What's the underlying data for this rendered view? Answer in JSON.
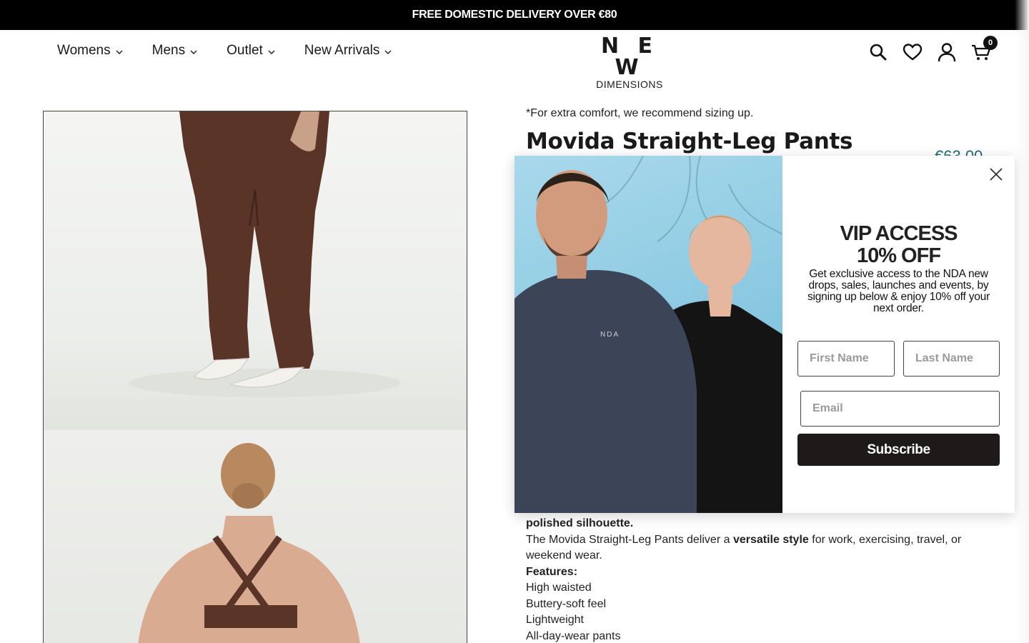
{
  "announcement": "FREE DOMESTIC DELIVERY OVER €80",
  "nav": {
    "womens": "Womens",
    "mens": "Mens",
    "outlet": "Outlet",
    "new_arrivals": "New Arrivals"
  },
  "logo": {
    "top": "N E W",
    "bottom": "DIMENSIONS"
  },
  "header_icons": [
    "search-icon",
    "heart-icon",
    "account-icon",
    "cart-icon"
  ],
  "cart_count": "0",
  "product": {
    "sizing_note": "*For extra comfort, we recommend sizing up.",
    "title": "Movida Straight-Leg Pants",
    "price": "€63.00",
    "desc_bold_1": "polished silhouette.",
    "desc_p2_a": "The Movida Straight-Leg Pants deliver a ",
    "desc_p2_bold": "versatile style",
    "desc_p2_b": " for work, exercising, travel, or weekend wear.",
    "features_heading": "Features:",
    "features": [
      "High waisted",
      "Buttery-soft feel",
      "Lightweight",
      "All-day-wear pants"
    ]
  },
  "popup": {
    "heading_line1": "VIP ACCESS",
    "heading_line2": "10% OFF",
    "description": "Get exclusive access to the NDA new drops, sales, launches and events, by signing up below & enjoy 10% off your next order.",
    "first_name_placeholder": "First Name",
    "last_name_placeholder": "Last Name",
    "email_placeholder": "Email",
    "subscribe_label": "Subscribe",
    "shirt_logo": "NDA"
  },
  "colors": {
    "price": "#1e6a72",
    "subscribe_bg": "#1f1a1a",
    "announcement_bg": "#000000"
  }
}
